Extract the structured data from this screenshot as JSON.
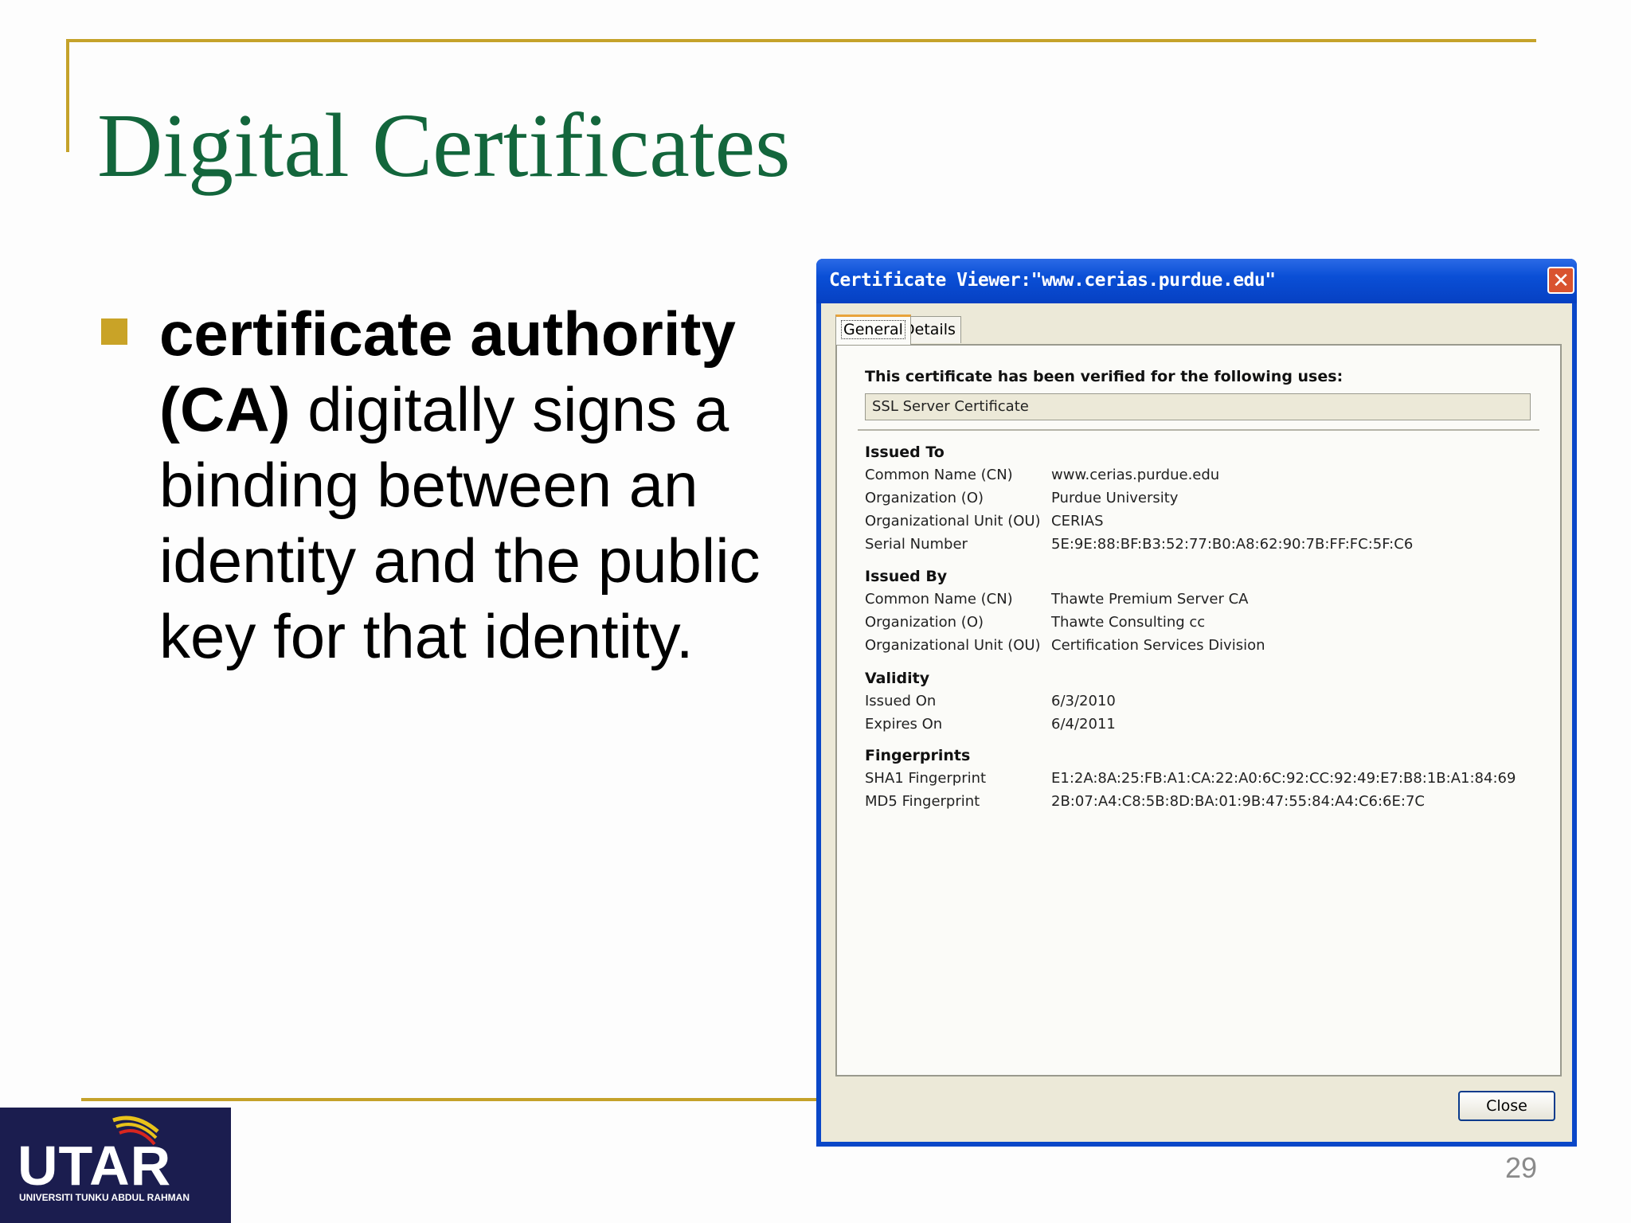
{
  "slide": {
    "title": "Digital Certificates",
    "bullet_bold": "certificate authority (CA)",
    "bullet_rest": " digitally signs a binding between an identity and the public key for that identity.",
    "page_number": "29",
    "logo_text": "UTAR",
    "logo_subtext": "UNIVERSITI TUNKU ABDUL RAHMAN"
  },
  "dialog": {
    "title": "Certificate Viewer:\"www.cerias.purdue.edu\"",
    "close_icon": "close-x",
    "tabs": [
      {
        "label": "General"
      },
      {
        "label": "Details"
      }
    ],
    "verified_label": "This certificate has been verified for the following uses:",
    "uses_value": "SSL Server Certificate",
    "issued_to": {
      "heading": "Issued To",
      "rows": [
        {
          "key": "Common Name (CN)",
          "value": "www.cerias.purdue.edu"
        },
        {
          "key": "Organization (O)",
          "value": "Purdue University"
        },
        {
          "key": "Organizational Unit (OU)",
          "value": "CERIAS"
        },
        {
          "key": "Serial Number",
          "value": "5E:9E:88:BF:B3:52:77:B0:A8:62:90:7B:FF:FC:5F:C6"
        }
      ]
    },
    "issued_by": {
      "heading": "Issued By",
      "rows": [
        {
          "key": "Common Name (CN)",
          "value": "Thawte Premium Server CA"
        },
        {
          "key": "Organization (O)",
          "value": "Thawte Consulting cc"
        },
        {
          "key": "Organizational Unit (OU)",
          "value": "Certification Services Division"
        }
      ]
    },
    "validity": {
      "heading": "Validity",
      "rows": [
        {
          "key": "Issued On",
          "value": "6/3/2010"
        },
        {
          "key": "Expires On",
          "value": "6/4/2011"
        }
      ]
    },
    "fingerprints": {
      "heading": "Fingerprints",
      "rows": [
        {
          "key": "SHA1 Fingerprint",
          "value": "E1:2A:8A:25:FB:A1:CA:22:A0:6C:92:CC:92:49:E7:B8:1B:A1:84:69"
        },
        {
          "key": "MD5 Fingerprint",
          "value": "2B:07:A4:C8:5B:8D:BA:01:9B:47:55:84:A4:C6:6E:7C"
        }
      ]
    },
    "close_button": "Close"
  },
  "colors": {
    "title_green": "#13663c",
    "accent_gold": "#c5a22a",
    "xp_blue": "#0a47c8",
    "logo_navy": "#1b1d4f"
  }
}
